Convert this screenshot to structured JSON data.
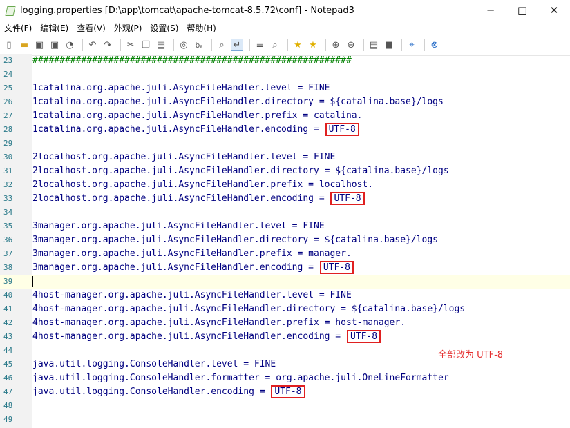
{
  "window": {
    "title": "logging.properties [D:\\app\\tomcat\\apache-tomcat-8.5.72\\conf] - Notepad3",
    "controls": [
      "minimize-icon",
      "maximize-icon",
      "close-icon"
    ]
  },
  "menu": {
    "items": [
      "文件(F)",
      "编辑(E)",
      "查看(V)",
      "外观(P)",
      "设置(S)",
      "帮助(H)"
    ]
  },
  "toolbar": {
    "icons": [
      "new-file-icon",
      "open-folder-icon",
      "save-icon",
      "save-as-icon",
      "browse-icon",
      "undo-icon",
      "redo-icon",
      "cut-icon",
      "copy-icon",
      "paste-icon",
      "find-icon",
      "replace-icon",
      "find-in-files-icon",
      "word-wrap-icon",
      "goto-icon",
      "search-highlight-icon",
      "favorite-icon",
      "add-favorite-icon",
      "zoom-in-icon",
      "zoom-out-icon",
      "schemes-icon",
      "console-icon",
      "pin-icon",
      "close-file-icon"
    ]
  },
  "editor": {
    "current_line": 39,
    "lines": [
      {
        "n": "23",
        "t": "###########################################################"
      },
      {
        "n": "24",
        "t": ""
      },
      {
        "n": "25",
        "t": "1catalina.org.apache.juli.AsyncFileHandler.level = FINE"
      },
      {
        "n": "26",
        "t": "1catalina.org.apache.juli.AsyncFileHandler.directory = ${catalina.base}/logs"
      },
      {
        "n": "27",
        "t": "1catalina.org.apache.juli.AsyncFileHandler.prefix = catalina."
      },
      {
        "n": "28",
        "t": "1catalina.org.apache.juli.AsyncFileHandler.encoding = ",
        "boxed": "UTF-8"
      },
      {
        "n": "29",
        "t": ""
      },
      {
        "n": "30",
        "t": "2localhost.org.apache.juli.AsyncFileHandler.level = FINE"
      },
      {
        "n": "31",
        "t": "2localhost.org.apache.juli.AsyncFileHandler.directory = ${catalina.base}/logs"
      },
      {
        "n": "32",
        "t": "2localhost.org.apache.juli.AsyncFileHandler.prefix = localhost."
      },
      {
        "n": "33",
        "t": "2localhost.org.apache.juli.AsyncFileHandler.encoding = ",
        "boxed": "UTF-8"
      },
      {
        "n": "34",
        "t": ""
      },
      {
        "n": "35",
        "t": "3manager.org.apache.juli.AsyncFileHandler.level = FINE"
      },
      {
        "n": "36",
        "t": "3manager.org.apache.juli.AsyncFileHandler.directory = ${catalina.base}/logs"
      },
      {
        "n": "37",
        "t": "3manager.org.apache.juli.AsyncFileHandler.prefix = manager."
      },
      {
        "n": "38",
        "t": "3manager.org.apache.juli.AsyncFileHandler.encoding = ",
        "boxed": "UTF-8"
      },
      {
        "n": "39",
        "t": ""
      },
      {
        "n": "40",
        "t": "4host-manager.org.apache.juli.AsyncFileHandler.level = FINE"
      },
      {
        "n": "41",
        "t": "4host-manager.org.apache.juli.AsyncFileHandler.directory = ${catalina.base}/logs"
      },
      {
        "n": "42",
        "t": "4host-manager.org.apache.juli.AsyncFileHandler.prefix = host-manager."
      },
      {
        "n": "43",
        "t": "4host-manager.org.apache.juli.AsyncFileHandler.encoding = ",
        "boxed": "UTF-8"
      },
      {
        "n": "44",
        "t": ""
      },
      {
        "n": "45",
        "t": "java.util.logging.ConsoleHandler.level = FINE"
      },
      {
        "n": "46",
        "t": "java.util.logging.ConsoleHandler.formatter = org.apache.juli.OneLineFormatter"
      },
      {
        "n": "47",
        "t": "java.util.logging.ConsoleHandler.encoding = ",
        "boxed": "UTF-8"
      },
      {
        "n": "48",
        "t": ""
      },
      {
        "n": "49",
        "t": ""
      }
    ]
  },
  "annotation": {
    "text": "全部改为 UTF-8",
    "color": "#e53030"
  },
  "colors": {
    "comment": "#008000",
    "code": "#000080",
    "line_number": "#2b7a8a",
    "highlight_box": "#e02020",
    "current_line_bg": "#ffffe6"
  }
}
